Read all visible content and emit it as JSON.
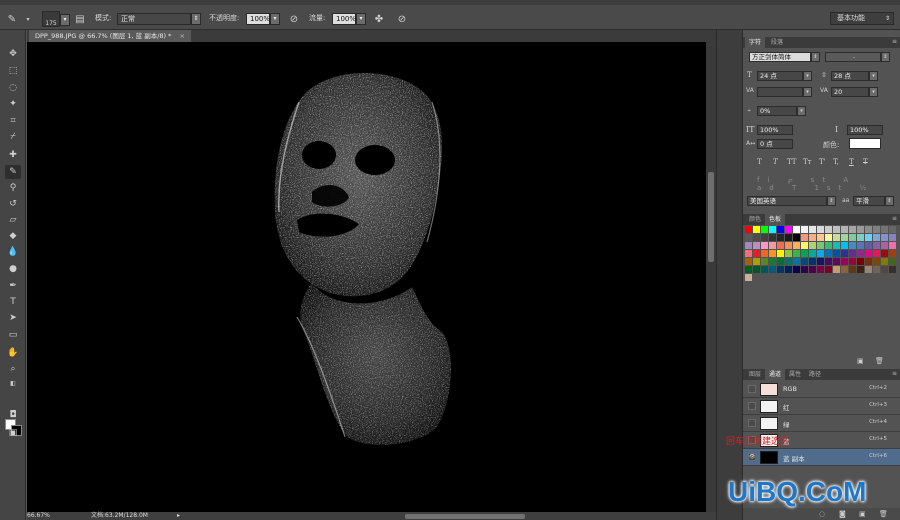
{
  "options_bar": {
    "brush_size": "175",
    "mode_label": "模式:",
    "mode_value": "正常",
    "opacity_label": "不透明度:",
    "opacity_value": "100%",
    "flow_label": "流量:",
    "flow_value": "100%",
    "workspace": "基本功能"
  },
  "document": {
    "tab_title": "DPP_988.JPG @ 66.7% (图层 1, 蓝 副本/8) *",
    "tab_close": "×",
    "zoom": "66.67%",
    "doc_size": "文档:63.2M/128.0M"
  },
  "char_panel": {
    "tabs": [
      "字符",
      "段落"
    ],
    "font_family": "方正剑体简体",
    "font_style": "-",
    "font_size": "24 点",
    "leading": "28 点",
    "kerning": "",
    "tracking": "20",
    "scale_pct": "0%",
    "vscale": "100%",
    "hscale": "100%",
    "baseline": "0 点",
    "color_label": "颜色:",
    "type_buttons": [
      "T",
      "T",
      "TT",
      "Tт",
      "T'",
      "T,",
      "T",
      "T"
    ],
    "language": "美国英语",
    "aa_label": "aa",
    "aa_value": "平滑"
  },
  "swatches_panel": {
    "tabs": [
      "颜色",
      "色板"
    ],
    "colors": [
      "#ff0000",
      "#ffff00",
      "#00ff00",
      "#00ffff",
      "#0000ff",
      "#ff00ff",
      "#ffffff",
      "#f2f2f2",
      "#e6e6e6",
      "#d9d9d9",
      "#cccccc",
      "#bfbfbf",
      "#b3b3b3",
      "#a6a6a6",
      "#999999",
      "#8c8c8c",
      "#808080",
      "#737373",
      "#666666",
      "#595959",
      "#4d4d4d",
      "#404040",
      "#333333",
      "#262626",
      "#1a1a1a",
      "#000000",
      "#f7977a",
      "#f9ad81",
      "#fdc68a",
      "#fff79a",
      "#c4df9b",
      "#a3d39c",
      "#82ca9d",
      "#7bcdc8",
      "#6ecff6",
      "#7ea7d8",
      "#8493ca",
      "#8882be",
      "#a187be",
      "#bc8dbf",
      "#f49ac2",
      "#f6989d",
      "#f26c4f",
      "#f68e55",
      "#fbaf5c",
      "#fff467",
      "#acd372",
      "#7cc576",
      "#3bb878",
      "#1abbb4",
      "#00bff3",
      "#438cca",
      "#5574b9",
      "#605ca8",
      "#855fa8",
      "#a763a8",
      "#f06ea9",
      "#f26d7d",
      "#ed1c24",
      "#f26522",
      "#f7941d",
      "#fff200",
      "#8dc73f",
      "#39b54a",
      "#00a651",
      "#00a99d",
      "#00aeef",
      "#0072bc",
      "#0054a6",
      "#2e3192",
      "#662d91",
      "#92278f",
      "#ec008c",
      "#ed145b",
      "#9e0b0f",
      "#a0410d",
      "#a36209",
      "#aba000",
      "#598527",
      "#1a7b30",
      "#007236",
      "#00746b",
      "#0076a3",
      "#004b80",
      "#003471",
      "#1b1464",
      "#440e62",
      "#630460",
      "#9e005d",
      "#9e0039",
      "#790000",
      "#7b2e00",
      "#7d4900",
      "#827b00",
      "#406618",
      "#005e20",
      "#005826",
      "#005952",
      "#005b7f",
      "#003663",
      "#002157",
      "#0d004c",
      "#32004b",
      "#4b0049",
      "#7b0046",
      "#7a0026",
      "#c69c6e",
      "#8c6239",
      "#603913",
      "#3c2415",
      "#998675",
      "#736357",
      "#534741",
      "#362f2d",
      "#c7b299"
    ]
  },
  "channels_panel": {
    "tabs": [
      "图层",
      "通道",
      "属性",
      "路径"
    ],
    "rows": [
      {
        "name": "RGB",
        "shortcut": "Ctrl+2",
        "visible": false
      },
      {
        "name": "红",
        "shortcut": "Ctrl+3",
        "visible": false
      },
      {
        "name": "绿",
        "shortcut": "Ctrl+4",
        "visible": false
      },
      {
        "name": "蓝",
        "shortcut": "Ctrl+5",
        "visible": false
      },
      {
        "name": "蓝 副本",
        "shortcut": "Ctrl+6",
        "visible": true
      }
    ],
    "eye_glyph": "👁"
  },
  "overlay": {
    "red_caption": "回车后创建选区",
    "watermark": "UiBQ.CoM"
  }
}
